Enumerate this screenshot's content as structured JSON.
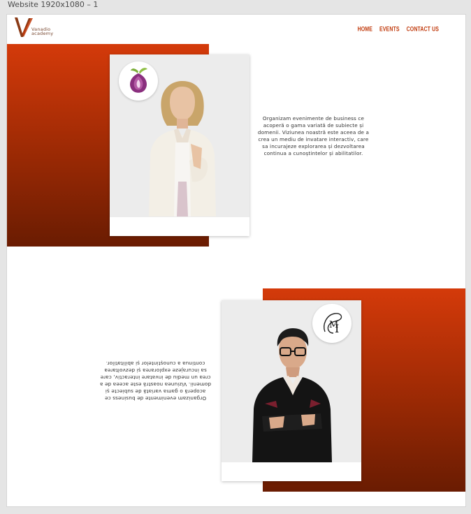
{
  "window": {
    "frame_title": "Website 1920x1080 – 1"
  },
  "brand": {
    "name_line1": "Vanadio",
    "name_line2": "academy",
    "logo_letter": "V"
  },
  "nav": {
    "items": [
      "HOME",
      "EVENTS",
      "CONTACT US"
    ]
  },
  "section1": {
    "text": "Organizam evenimente de business  ce acoperă o gama variată de subiecte și domenii. Viziunea noastră este aceea de a crea un mediu de invatare interactiv, care sa incurajeze explorarea și dezvoltarea continua a cunoștintelor și abilitatilor."
  },
  "section2": {
    "text": "Organizam evenimente de business  ce acoperă o gama variată de subiecte și domenii. Viziunea noastră este aceea de a crea un mediu de invatare interactiv, care sa incurajeze explorarea și dezvoltarea continua a cunoștintelor și abilitatilor.",
    "mirrored": true
  },
  "cards": [
    {
      "badge_icon": "onion-logo-icon",
      "photo": "woman-portrait"
    },
    {
      "badge_icon": "monogram-logo-icon",
      "badge_letters": "M I",
      "photo": "man-portrait"
    }
  ],
  "colors": {
    "accent": "#c0390b",
    "gradient_top": "#d43a0a",
    "gradient_bottom": "#6a1c02",
    "canvas": "#e5e5e5"
  }
}
